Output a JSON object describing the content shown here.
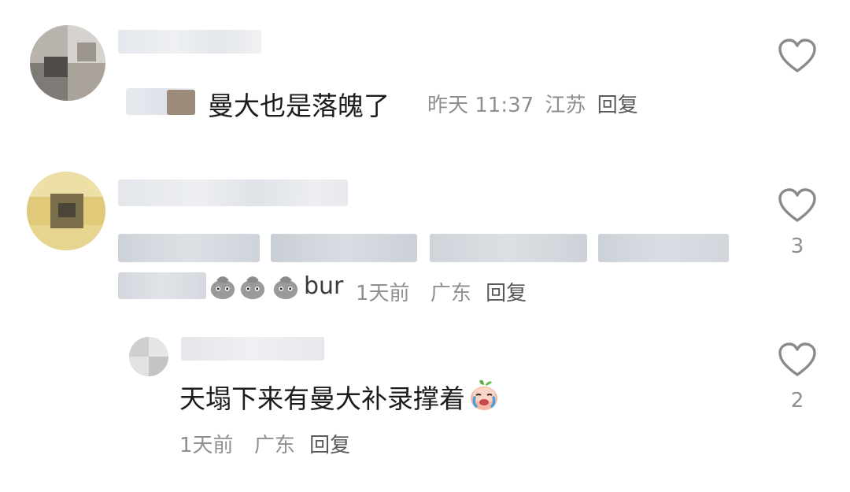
{
  "comments": [
    {
      "content": "曼大也是落魄了",
      "time": "昨天 11:37",
      "location": "江苏",
      "reply_label": "回复",
      "likes": ""
    },
    {
      "content_suffix": "bur",
      "time": "1天前",
      "location": "广东",
      "reply_label": "回复",
      "likes": "3"
    },
    {
      "content": "天塌下来有曼大补录撑着",
      "time": "1天前",
      "location": "广东",
      "reply_label": "回复",
      "likes": "2"
    }
  ],
  "icons": {
    "like": "heart-outline-icon",
    "emoji_sack": "money-bag-face-emoji",
    "emoji_cry": "crying-peach-emoji"
  },
  "colors": {
    "content": "#1c1c1c",
    "meta": "#8f8f8f",
    "icon_stroke": "#8a8a8a"
  }
}
